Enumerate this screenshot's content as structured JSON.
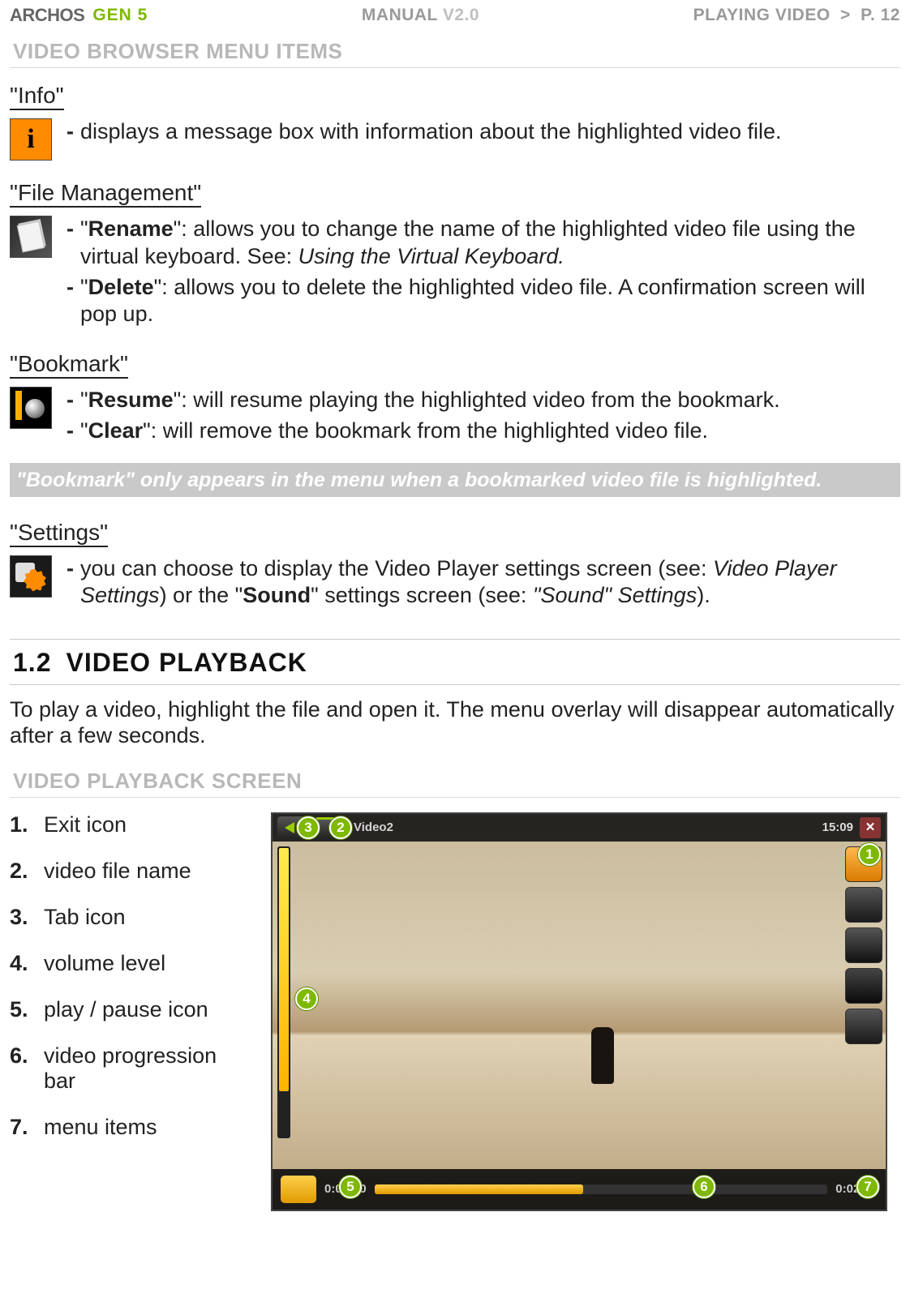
{
  "header": {
    "logo": "ARCHOS",
    "gen": "GEN 5",
    "manual": "MANUAL",
    "version": "V2.0",
    "breadcrumb": "PLAYING VIDEO",
    "caret": ">",
    "page": "P. 12"
  },
  "section_menu": {
    "heading": "VIDEO BROWSER MENU ITEMS",
    "info": {
      "title": "\"Info\"",
      "b1": "displays a message box with information about the highlighted video file."
    },
    "file": {
      "title": "\"File Management\"",
      "b1_label": "Rename",
      "b1_text": ": allows you to change the name of the highlighted video file using the virtual keyboard. See: ",
      "b1_ital": "Using the Virtual Keyboard.",
      "b2_label": "Delete",
      "b2_text": ": allows you to delete the highlighted video file. A confirmation screen will pop up."
    },
    "bookmark": {
      "title": "\"Bookmark\"",
      "b1_label": "Resume",
      "b1_text": ": will resume playing the highlighted video from the bookmark.",
      "b2_label": "Clear",
      "b2_text": ": will remove the bookmark from the highlighted video file."
    },
    "note": "\"Bookmark\" only appears in the menu when a bookmarked video file is highlighted.",
    "settings": {
      "title": "\"Settings\"",
      "b1_pre": "you can choose to display the Video Player settings screen (see: ",
      "b1_ital1": "Video Player Settings",
      "b1_mid": ") or the \"",
      "b1_bold": "Sound",
      "b1_mid2": "\" settings screen (see: ",
      "b1_ital2": "\"Sound\" Settings",
      "b1_end": ")."
    }
  },
  "section_playback": {
    "num": "1.2",
    "title": "VIDEO PLAYBACK",
    "para": "To play a video, highlight the file and open it. The menu overlay will disappear automatically after a few seconds.",
    "sub": "VIDEO PLAYBACK SCREEN",
    "list": [
      "Exit icon",
      "video file name",
      "Tab icon",
      "volume level",
      "play / pause icon",
      "video progression bar",
      "menu items"
    ],
    "player": {
      "title": "Video2",
      "clock": "15:09",
      "close": "✕",
      "time_elapsed": "0:01:10",
      "time_total": "0:02:46",
      "markers": [
        "1",
        "2",
        "3",
        "4",
        "5",
        "6",
        "7"
      ]
    }
  }
}
